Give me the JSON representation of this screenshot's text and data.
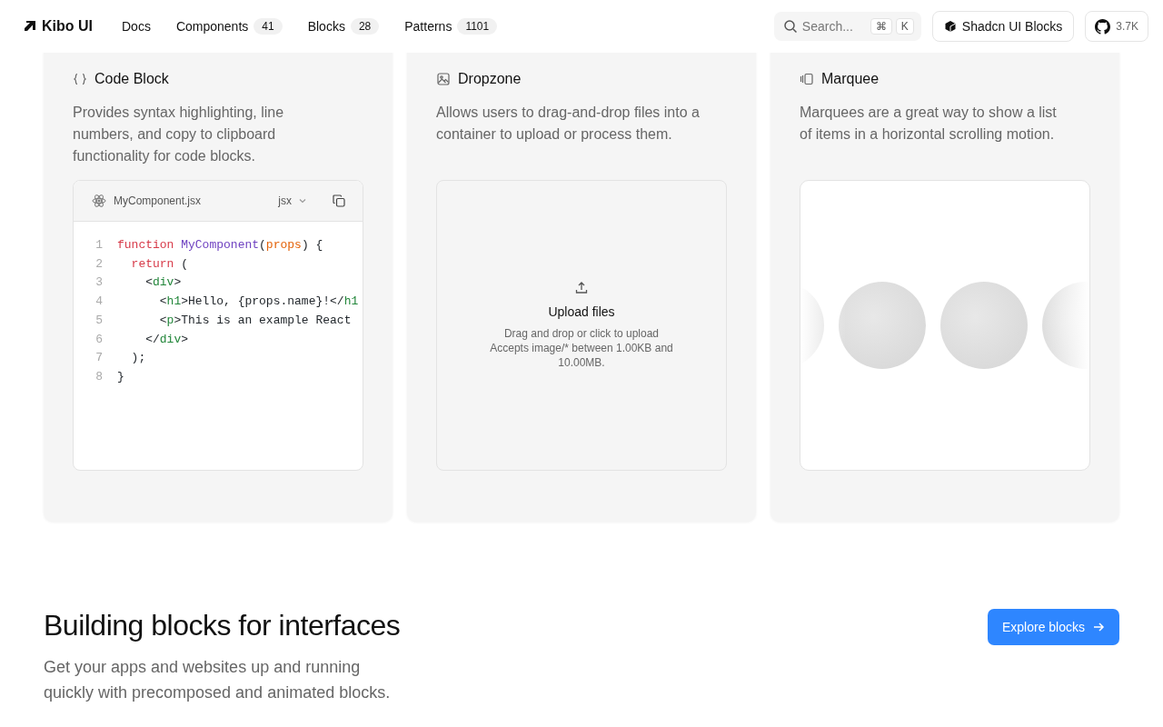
{
  "header": {
    "logo": "Kibo UI",
    "nav": [
      {
        "label": "Docs"
      },
      {
        "label": "Components",
        "count": "41"
      },
      {
        "label": "Blocks",
        "count": "28"
      },
      {
        "label": "Patterns",
        "count": "1101"
      }
    ],
    "search": {
      "placeholder": "Search...",
      "keys": [
        "⌘",
        "K"
      ]
    },
    "blocks_button": "Shadcn UI Blocks",
    "github_stars": "3.7K"
  },
  "cards": [
    {
      "kind": "code",
      "title": "Code Block",
      "description": "Provides syntax highlighting, line numbers, and copy to clipboard functionality for code blocks.",
      "filename": "MyComponent.jsx",
      "language": "jsx",
      "lines": [
        {
          "number": "1",
          "tokens": [
            {
              "kind": "keyword",
              "text": "function "
            },
            {
              "kind": "fn",
              "text": "MyComponent"
            },
            {
              "kind": "plain",
              "text": "("
            },
            {
              "kind": "param",
              "text": "props"
            },
            {
              "kind": "plain",
              "text": ") {"
            }
          ]
        },
        {
          "number": "2",
          "tokens": [
            {
              "kind": "keyword",
              "text": "  return"
            },
            {
              "kind": "plain",
              "text": " ("
            }
          ]
        },
        {
          "number": "3",
          "tokens": [
            {
              "kind": "plain",
              "text": "    <"
            },
            {
              "kind": "tag",
              "text": "div"
            },
            {
              "kind": "plain",
              "text": ">"
            }
          ]
        },
        {
          "number": "4",
          "tokens": [
            {
              "kind": "plain",
              "text": "      <"
            },
            {
              "kind": "tag",
              "text": "h1"
            },
            {
              "kind": "plain",
              "text": ">Hello, {props.name}!</"
            },
            {
              "kind": "tag",
              "text": "h1"
            }
          ]
        },
        {
          "number": "5",
          "tokens": [
            {
              "kind": "plain",
              "text": "      <"
            },
            {
              "kind": "tag",
              "text": "p"
            },
            {
              "kind": "plain",
              "text": ">This is an example React"
            }
          ]
        },
        {
          "number": "6",
          "tokens": [
            {
              "kind": "plain",
              "text": "    </"
            },
            {
              "kind": "tag",
              "text": "div"
            },
            {
              "kind": "plain",
              "text": ">"
            }
          ]
        },
        {
          "number": "7",
          "tokens": [
            {
              "kind": "plain",
              "text": "  );"
            }
          ]
        },
        {
          "number": "8",
          "tokens": [
            {
              "kind": "plain",
              "text": "}"
            }
          ]
        }
      ]
    },
    {
      "kind": "dropzone",
      "title": "Dropzone",
      "description": "Allows users to drag-and-drop files into a container to upload or process them.",
      "heading": "Upload files",
      "hint": "Drag and drop or click to upload",
      "accepts": "Accepts image/* between 1.00KB and 10.00MB."
    },
    {
      "kind": "marquee",
      "title": "Marquee",
      "description": "Marquees are a great way to show a list of items in a horizontal scrolling motion."
    }
  ],
  "section": {
    "title": "Building blocks for interfaces",
    "description": "Get your apps and websites up and running quickly with precomposed and animated blocks.",
    "button": "Explore blocks"
  }
}
